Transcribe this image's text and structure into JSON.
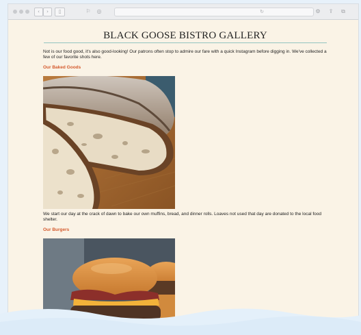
{
  "page": {
    "title": "BLACK GOOSE BISTRO GALLERY",
    "intro": "Not is our food good, it's also good-looking! Our patrons often stop to admire our fare with a quick Instagram before digging in. We've collected a few of our favorite shots here.",
    "sections": [
      {
        "heading": "Our Baked Goods",
        "image_subject": "sliced sourdough bread loaf on wooden board",
        "caption": "We start our day at the crack of dawn to bake our own muffins, bread, and dinner rolls. Loaves not used that day are donated to the local food shelter."
      },
      {
        "heading": "Our Burgers",
        "image_subject": "stacked bacon cheeseburgers on brioche buns"
      }
    ]
  },
  "colors": {
    "background": "#faf3e6",
    "heading_accent": "#d4592c",
    "title_rule": "#93c4c0"
  },
  "toolbar_icons": [
    "traffic-lights",
    "back-forward",
    "sidebar-icon",
    "reader-icon",
    "share-icon",
    "reload-icon",
    "downloads-icon",
    "share-icon-right",
    "tabs-icon"
  ]
}
